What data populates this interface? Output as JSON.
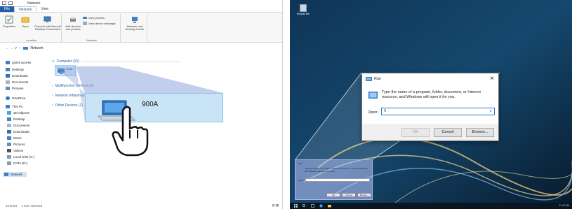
{
  "explorer": {
    "window_title": "Network",
    "menu_tabs": [
      "File",
      "Network",
      "View"
    ],
    "ribbon": {
      "location": {
        "group_name": "Location",
        "buttons": [
          {
            "label": "Properties"
          },
          {
            "label": "Open"
          },
          {
            "label": "Connect with Remote Desktop Connection"
          }
        ]
      },
      "network": {
        "group_name": "Network",
        "buttons": [
          {
            "label": "Add devices and printers"
          },
          {
            "label": "View printers"
          },
          {
            "label": "View device webpage"
          }
        ]
      },
      "center": {
        "buttons": [
          {
            "label": "Network and Sharing Center"
          }
        ]
      }
    },
    "address": {
      "nav_arrows": "← → ∨ ↑",
      "path": "Network"
    },
    "nav_items": [
      {
        "label": "Quick access",
        "icon": "star-icon"
      },
      {
        "label": "Desktop",
        "icon": "desktop-icon"
      },
      {
        "label": "Downloads",
        "icon": "download-icon"
      },
      {
        "label": "Documents",
        "icon": "documents-icon"
      },
      {
        "label": "Pictures",
        "icon": "pictures-icon"
      },
      {
        "label": "OneDrive",
        "icon": "cloud-icon"
      },
      {
        "label": "This PC",
        "icon": "pc-icon"
      },
      {
        "label": "3D Objects",
        "icon": "cube-icon"
      },
      {
        "label": "Desktop",
        "icon": "desktop-icon"
      },
      {
        "label": "Documents",
        "icon": "documents-icon"
      },
      {
        "label": "Downloads",
        "icon": "download-icon"
      },
      {
        "label": "Music",
        "icon": "music-icon"
      },
      {
        "label": "Pictures",
        "icon": "pictures-icon"
      },
      {
        "label": "Videos",
        "icon": "video-icon"
      },
      {
        "label": "Local Disk (C:)",
        "icon": "drive-icon"
      },
      {
        "label": "DATA (D:)",
        "icon": "drive-icon"
      },
      {
        "label": "Network",
        "icon": "network-icon"
      }
    ],
    "groups": [
      {
        "label": "Computer (16)"
      },
      {
        "label": "Multifunction Devices (2)"
      },
      {
        "label": "Network Infrastructure"
      },
      {
        "label": "Other Devices (1)"
      }
    ],
    "selected_computer": "900A",
    "status": {
      "items": "19 items",
      "selected": "1 item selected"
    }
  },
  "desktop": {
    "recycle_label": "Recycle Bin",
    "run_dialog": {
      "title": "Run",
      "description": "Type the name of a program, folder, document, or Internet resource, and Windows will open it for you.",
      "open_label": "Open:",
      "input_value": "\\\\",
      "ok_label": "OK",
      "cancel_label": "Cancel",
      "browse_label": "Browse..."
    },
    "taskbar": {
      "clock": "11:42 AM"
    }
  },
  "colors": {
    "accent": "#1f5fa9",
    "selection": "#c9e3f7",
    "desktop_bg": "#0b2540"
  }
}
